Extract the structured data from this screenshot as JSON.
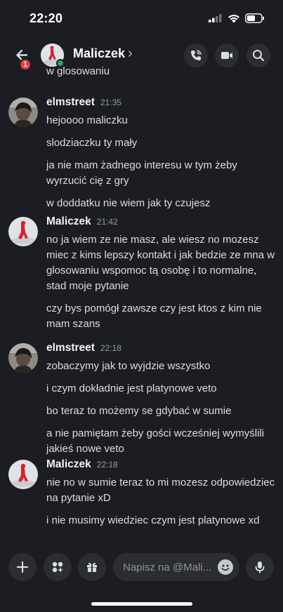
{
  "status_bar": {
    "time": "22:20"
  },
  "header": {
    "back_badge": "1",
    "title": "Maliczek",
    "chevron": "›",
    "icons": [
      "call-icon",
      "video-icon",
      "search-icon"
    ]
  },
  "cut_text": "w glosowaniu",
  "groups": [
    {
      "author": "elmstreet",
      "time": "21:35",
      "avatar": "elmstreet-avatar",
      "messages": [
        "hejoooo maliczku",
        "slodziaczku ty mały",
        "ja nie mam żadnego interesu w tym żeby wyrzucić cię z gry",
        "w doddatku nie wiem jak ty czujesz"
      ]
    },
    {
      "author": "Maliczek",
      "time": "21:42",
      "avatar": "maliczek-avatar",
      "messages": [
        "no ja wiem ze nie masz, ale wiesz no mozesz miec z kims lepszy kontakt i jak bedzie ze mna w glosowaniu wspomoc tą osobę i to normalne, stad moje pytanie",
        "czy bys pomógł zawsze czy jest ktos z kim nie mam szans"
      ]
    },
    {
      "author": "elmstreet",
      "time": "22:18",
      "avatar": "elmstreet-avatar",
      "messages": [
        "zobaczymy jak to wyjdzie wszystko",
        "i czym dokładnie jest platynowe veto",
        "bo teraz to możemy se gdybać w sumie",
        "a nie pamiętam żeby gości wcześniej wymyślili jakieś nowe veto"
      ]
    },
    {
      "author": "Maliczek",
      "time": "22:18",
      "avatar": "maliczek-avatar",
      "messages": [
        "nie no w sumie teraz to mi mozesz odpowiedziec na pytanie xD",
        "i nie musimy wiedziec czym jest platynowe xd"
      ]
    }
  ],
  "composer": {
    "placeholder": "Napisz na @Mali...",
    "buttons": [
      "plus-icon",
      "apps-icon",
      "gift-icon",
      "microphone-icon"
    ]
  }
}
